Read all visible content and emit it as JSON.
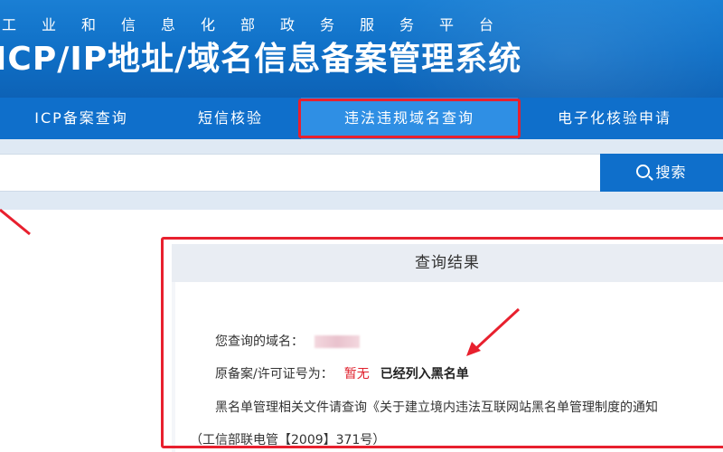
{
  "header": {
    "subtitle": "工业和信息化部政务服务平台",
    "title": "ICP/IP地址/域名信息备案管理系统"
  },
  "nav": {
    "items": [
      {
        "label": "ICP备案查询"
      },
      {
        "label": "短信核验"
      },
      {
        "label": "违法违规域名查询"
      },
      {
        "label": "电子化核验申请"
      }
    ],
    "active_index": 2
  },
  "search": {
    "value": "",
    "placeholder": "",
    "button_label": "搜索",
    "button_icon": "search-icon"
  },
  "results": {
    "title": "查询结果",
    "domain_label": "您查询的域名：",
    "license_label": "原备案/许可证号为：",
    "license_value": "暂无",
    "blacklist_status": "已经列入黑名单",
    "doc_line": "黑名单管理相关文件请查询《关于建立境内违法互联网站黑名单管理制度的通知",
    "doc_ref": "（工信部联电管【2009】371号）"
  },
  "colors": {
    "brand_blue": "#0f6fcb",
    "highlight_red": "#e8202e",
    "status_red": "#e0202c"
  }
}
